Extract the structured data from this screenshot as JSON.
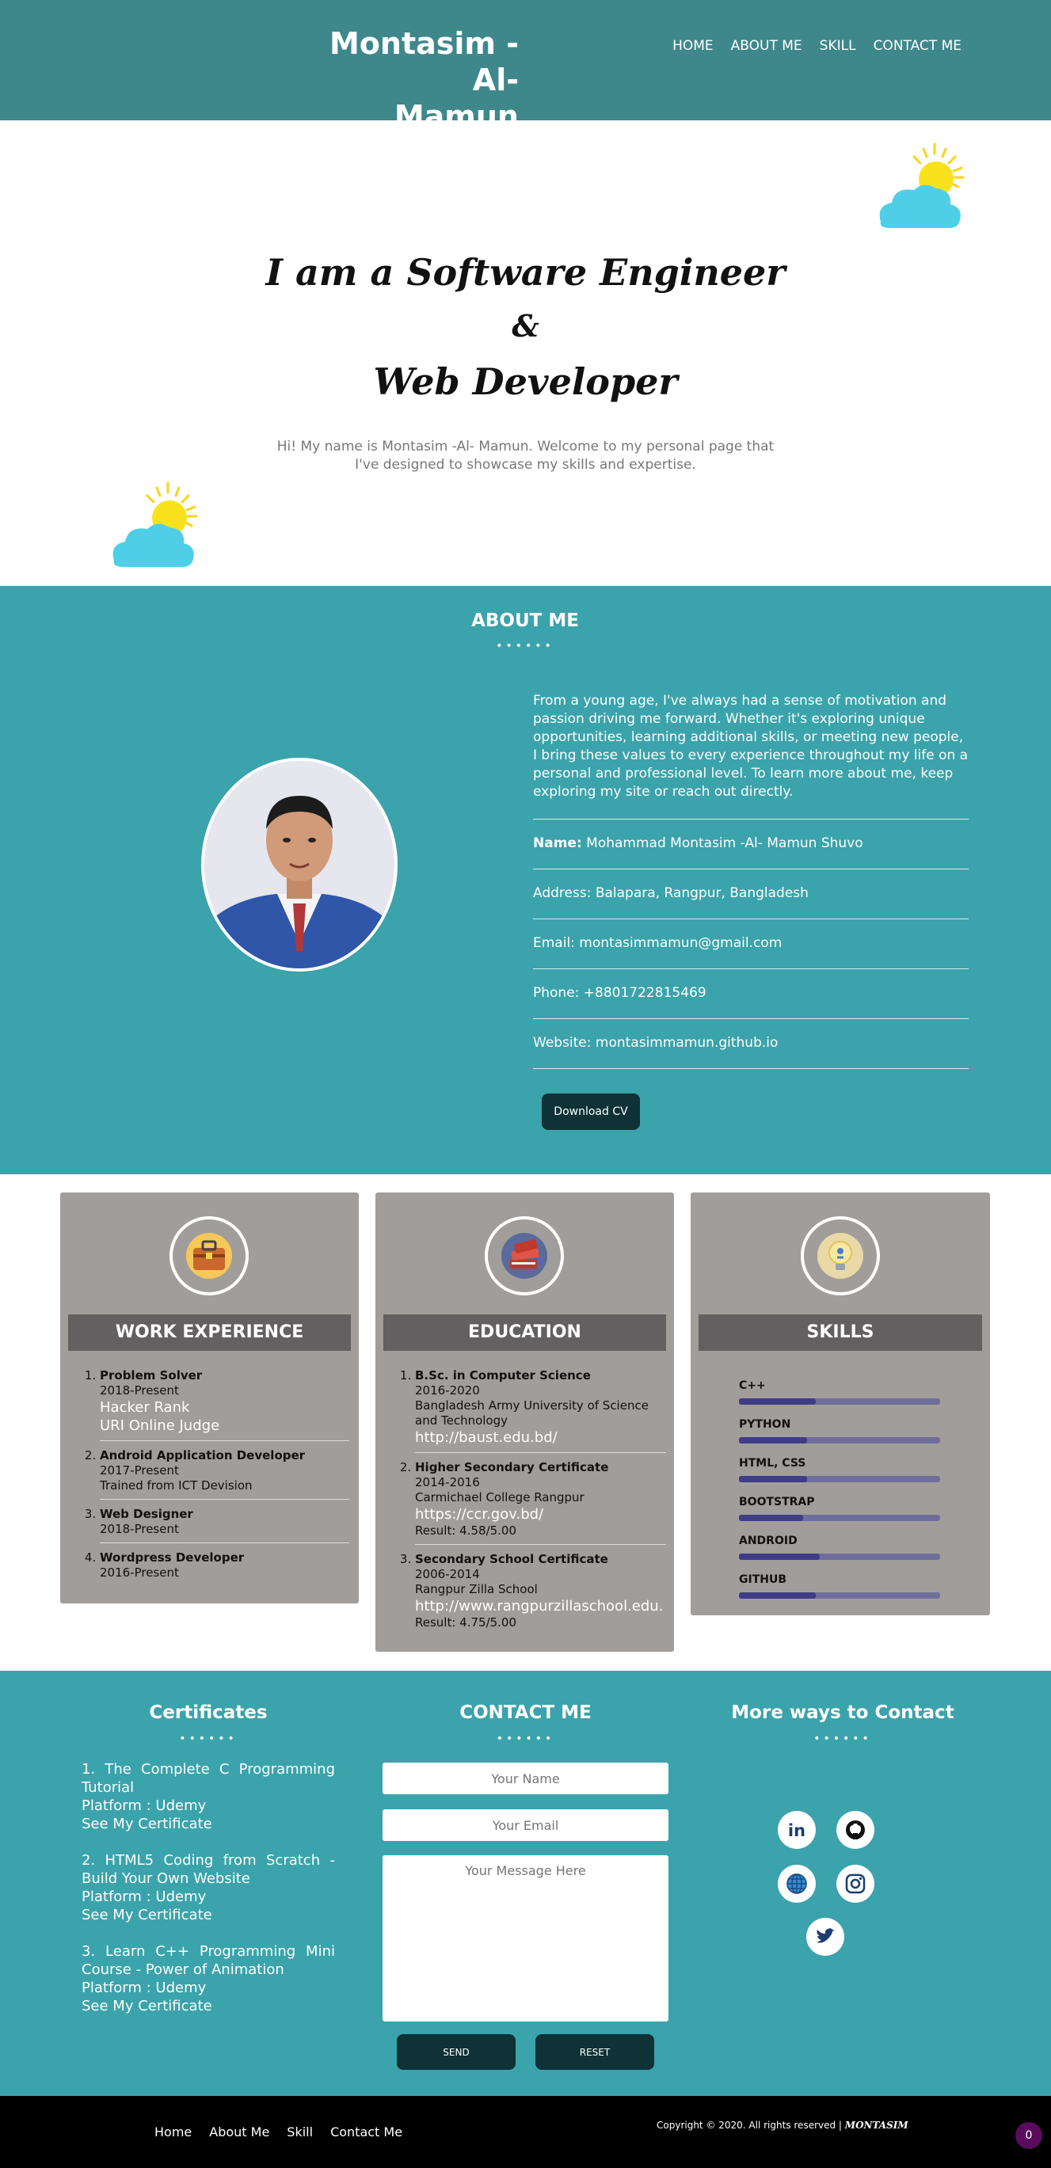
{
  "header": {
    "brand_line1": "Montasim -Al-",
    "brand_line2": "Mamun",
    "nav": [
      "HOME",
      "ABOUT ME",
      "SKILL",
      "CONTACT ME"
    ]
  },
  "hero": {
    "title_line1": "I am a Software Engineer",
    "title_line2": "&",
    "title_line3": "Web Developer",
    "subtitle_line1": "Hi! My name is Montasim -Al- Mamun. Welcome to my personal page that",
    "subtitle_line2": "I've designed to showcase my skills and expertise."
  },
  "about": {
    "title": "ABOUT ME",
    "dots": "••••••",
    "bio": "From a young age, I've always had a sense of motivation and passion driving me forward. Whether it's exploring unique opportunities, learning additional skills, or meeting new people, I bring these values to every experience throughout my life on a personal and professional level. To learn more about me, keep exploring my site or reach out directly.",
    "name_label": "Name:",
    "name_value": " Mohammad Montasim -Al- Mamun Shuvo",
    "address": "Address: Balapara, Rangpur, Bangladesh",
    "email": "Email: montasimmamun@gmail.com",
    "phone": "Phone: +8801722815469",
    "website": "Website: montasimmamun.github.io",
    "download_label": "Download CV"
  },
  "work": {
    "title": "WORK EXPERIENCE",
    "items": [
      {
        "title": "Problem Solver",
        "period": "2018-Present",
        "link1": "Hacker Rank",
        "link2": "URI Online Judge"
      },
      {
        "title": "Android Application Developer",
        "period": "2017-Present",
        "note": "Trained from ICT Devision"
      },
      {
        "title": "Web Designer",
        "period": "2018-Present"
      },
      {
        "title": "Wordpress Developer",
        "period": "2016-Present"
      }
    ]
  },
  "education": {
    "title": "EDUCATION",
    "items": [
      {
        "title": "B.Sc. in Computer Science",
        "period": "2016-2020",
        "place": "Bangladesh Army University of Science and Technology",
        "link": "http://baust.edu.bd/"
      },
      {
        "title": "Higher Secondary Certificate",
        "period": "2014-2016",
        "place": "Carmichael College Rangpur",
        "link": "https://ccr.gov.bd/",
        "result": "Result: 4.58/5.00"
      },
      {
        "title": "Secondary School Certificate",
        "period": "2006-2014",
        "place": "Rangpur Zilla School",
        "link": "http://www.rangpurzillaschool.edu.bd/",
        "result": "Result: 4.75/5.00"
      }
    ]
  },
  "skills": {
    "title": "SKILLS",
    "items": [
      {
        "name": "C++",
        "level": 0.38
      },
      {
        "name": "PYTHON",
        "level": 0.34
      },
      {
        "name": "HTML, CSS",
        "level": 0.34
      },
      {
        "name": "BOOTSTRAP",
        "level": 0.32
      },
      {
        "name": "ANDROID",
        "level": 0.4
      },
      {
        "name": "GITHUB",
        "level": 0.38
      }
    ]
  },
  "certificates": {
    "title": "Certificates",
    "items": [
      {
        "name": "1. The Complete C Programming Tutorial",
        "platform": "Platform : Udemy",
        "link": "See My Certificate"
      },
      {
        "name": "2. HTML5 Coding from Scratch - Build Your Own Website",
        "platform": "Platform : Udemy",
        "link": "See My Certificate"
      },
      {
        "name": "3. Learn C++ Programming Mini Course - Power of Animation",
        "platform": "Platform : Udemy",
        "link": "See My Certificate"
      }
    ]
  },
  "contact": {
    "title": "CONTACT ME",
    "name_placeholder": "Your Name",
    "email_placeholder": "Your Email",
    "message_placeholder": "Your Message Here",
    "send_label": "SEND",
    "reset_label": "RESET"
  },
  "more": {
    "title": "More ways to Contact"
  },
  "footer": {
    "links": [
      "Home",
      "About Me",
      "Skill",
      "Contact Me"
    ],
    "copyright": "Copyright © 2020. All rights reserved | ",
    "signature": "MONTASIM",
    "counter": "0"
  },
  "colors": {
    "header_bg": "#3e888c",
    "section_bg": "#3ba3ab",
    "card_bg": "#a19d9b",
    "dark_button": "#0e3236"
  }
}
